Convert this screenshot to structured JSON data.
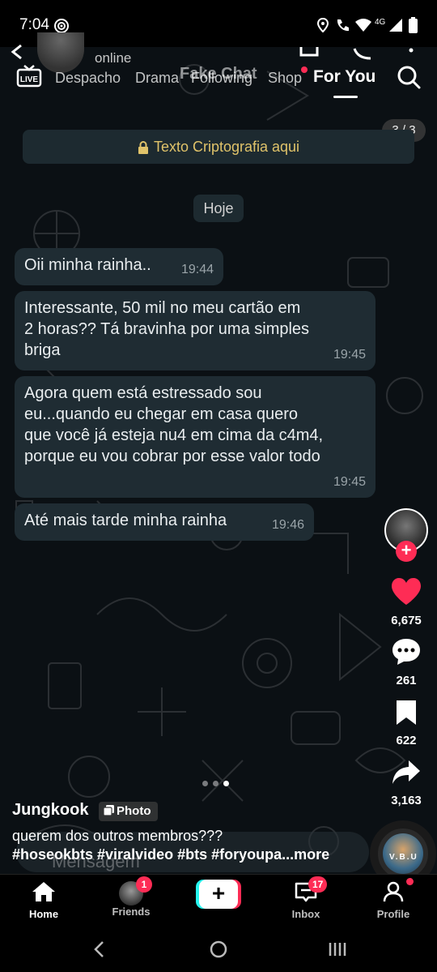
{
  "status_bar": {
    "time": "7:04",
    "network": "4G"
  },
  "chat_header": {
    "status": "online",
    "watermark": "Fake Chat"
  },
  "top_tabs": {
    "live_label": "LIVE",
    "items": [
      {
        "label": "Despacho"
      },
      {
        "label": "Drama"
      },
      {
        "label": "Following"
      },
      {
        "label": "Shop"
      },
      {
        "label": "For You"
      }
    ]
  },
  "photo_counter": "3 / 3",
  "encryption_banner": "Texto Criptografia aqui",
  "date_chip": "Hoje",
  "messages": [
    {
      "lines": [
        "Oii minha rainha.."
      ],
      "time": "19:44"
    },
    {
      "lines": [
        "Interessante, 50 mil no meu cartão em",
        "2 horas?? Tá bravinha por uma simples",
        "briga"
      ],
      "time": "19:45"
    },
    {
      "lines": [
        "Agora quem está estressado sou",
        "eu...quando eu chegar em casa quero",
        "que você já esteja nu4 em cima da c4m4,",
        "porque eu vou cobrar por esse valor todo"
      ],
      "time": "19:45"
    },
    {
      "lines": [
        "Até mais tarde minha rainha"
      ],
      "time": "19:46"
    }
  ],
  "actions": {
    "likes": "6,675",
    "comments": "261",
    "saves": "622",
    "shares": "3,163"
  },
  "carousel": {
    "total": 3,
    "current": 3
  },
  "post": {
    "author": "Jungkook",
    "type_badge": "Photo",
    "caption_line1": "querem dos outros membros???",
    "caption_line2": "#hoseokbts #viralvideo #bts #foryoupa...",
    "more_label": "more",
    "input_placeholder": "Mensagem",
    "music_label": "V.B.U"
  },
  "bottom_nav": {
    "home": "Home",
    "friends": "Friends",
    "friends_badge": "1",
    "inbox": "Inbox",
    "inbox_badge": "17",
    "profile": "Profile"
  },
  "colors": {
    "accent_red": "#fe2c55",
    "accent_cyan": "#25f4ee",
    "bubble": "#1f2c33",
    "chat_bg": "#0b1014"
  }
}
